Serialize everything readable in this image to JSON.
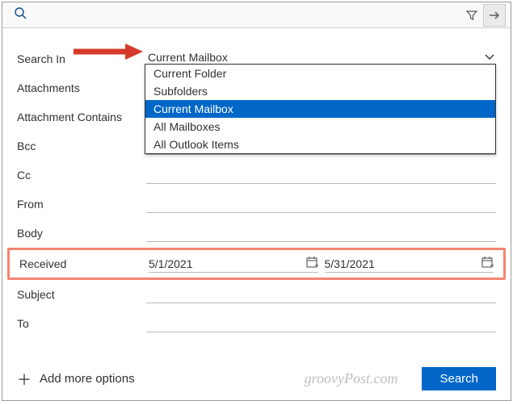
{
  "fields": {
    "search_in": {
      "label": "Search In",
      "value": "Current Mailbox",
      "options": [
        "Current Folder",
        "Subfolders",
        "Current Mailbox",
        "All Mailboxes",
        "All Outlook Items"
      ],
      "selected_index": 2
    },
    "attachments": {
      "label": "Attachments"
    },
    "attachment_contains": {
      "label": "Attachment Contains"
    },
    "bcc": {
      "label": "Bcc"
    },
    "cc": {
      "label": "Cc"
    },
    "from": {
      "label": "From"
    },
    "body": {
      "label": "Body"
    },
    "received": {
      "label": "Received",
      "from_date": "5/1/2021",
      "to_date": "5/31/2021"
    },
    "subject": {
      "label": "Subject"
    },
    "to": {
      "label": "To"
    }
  },
  "footer": {
    "add_more": "Add more options",
    "watermark": "groovyPost.com",
    "search_button": "Search"
  },
  "highlight": {
    "field": "received",
    "color": "#f58470"
  },
  "annotation_arrow": {
    "target": "search_in",
    "color": "#d63a2a"
  }
}
